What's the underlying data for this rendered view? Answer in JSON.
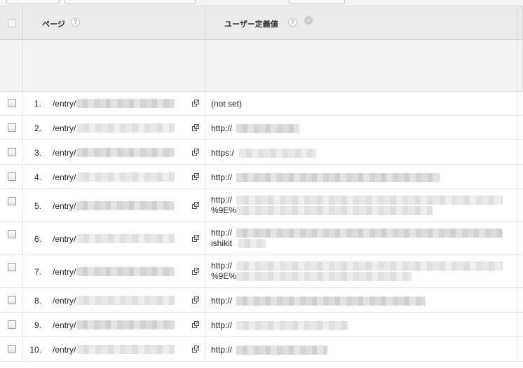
{
  "table": {
    "header": {
      "page_label": "ページ",
      "user_value_label": "ユーザー定義値",
      "help_glyph": "?",
      "remove_glyph": "×"
    },
    "rows": [
      {
        "num": "1.",
        "page": "/entry/",
        "value_line1": "(not set)",
        "value_line2": ""
      },
      {
        "num": "2.",
        "page": "/entry/",
        "value_line1": "http://",
        "value_line2": ""
      },
      {
        "num": "3.",
        "page": "/entry/",
        "value_line1": "https:/",
        "value_line2": ""
      },
      {
        "num": "4.",
        "page": "/entry/",
        "value_line1": "http://",
        "value_line2": ""
      },
      {
        "num": "5.",
        "page": "/entry/",
        "value_line1": "http://",
        "value_line2": "%9E%"
      },
      {
        "num": "6.",
        "page": "/entry/",
        "value_line1": "http://",
        "value_line2": "ishikit"
      },
      {
        "num": "7.",
        "page": "/entry/",
        "value_line1": "http://",
        "value_line2": "%9E%"
      },
      {
        "num": "8.",
        "page": "/entry/",
        "value_line1": "http://",
        "value_line2": ""
      },
      {
        "num": "9.",
        "page": "/entry/",
        "value_line1": "http://",
        "value_line2": ""
      },
      {
        "num": "10.",
        "page": "/entry/",
        "value_line1": "http://",
        "value_line2": ""
      }
    ]
  },
  "icons": {
    "select_all": "checkbox-icon",
    "help": "help-circle-icon",
    "remove": "remove-circle-icon",
    "open_page": "open-in-new-window-icon"
  },
  "colors": {
    "header_bg": "#ececec",
    "summary_bg": "#f3f3f3",
    "grid_line": "#e2e2e2"
  }
}
